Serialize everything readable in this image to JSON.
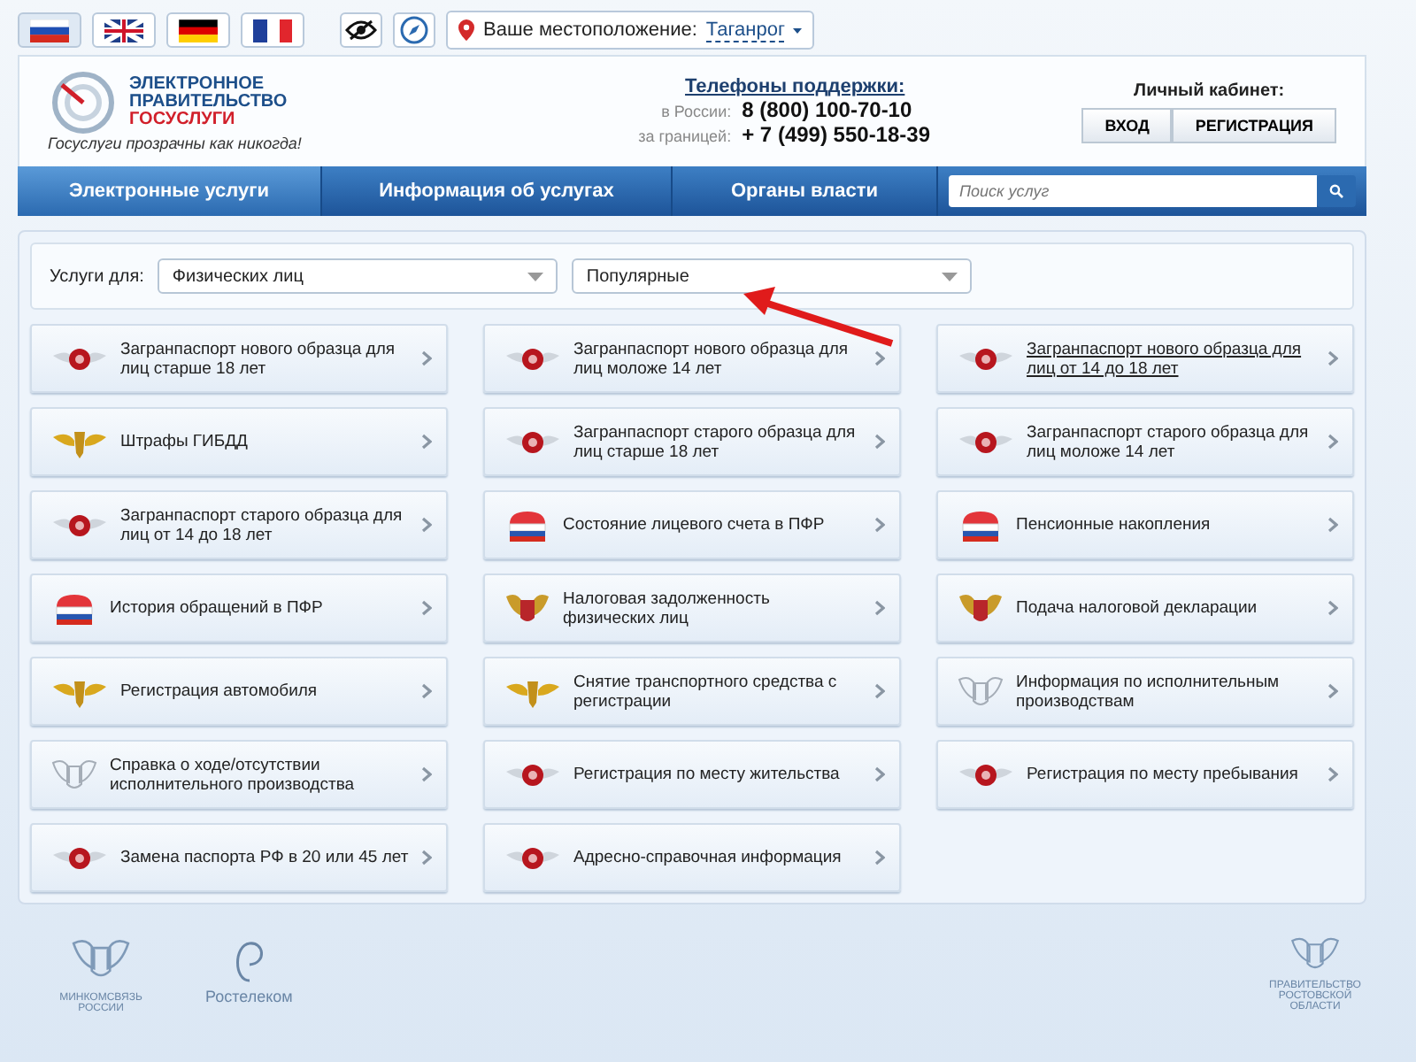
{
  "languages": [
    {
      "kind": "ru",
      "selected": true
    },
    {
      "kind": "en",
      "selected": false
    },
    {
      "kind": "de",
      "selected": false
    },
    {
      "kind": "fr",
      "selected": false
    }
  ],
  "location": {
    "label": "Ваше местоположение:",
    "value": "Таганрог"
  },
  "logo": {
    "line_1": "ЭЛЕКТРОННОЕ",
    "line_2": "ПРАВИТЕЛЬСТВО",
    "line_3": "ГОСУСЛУГИ",
    "slogan": "Госуслуги прозрачны как никогда!"
  },
  "support": {
    "title": "Телефоны поддержки:",
    "phones": [
      {
        "label": "в России:",
        "number": "8 (800) 100-70-10"
      },
      {
        "label": "за границей:",
        "number": "+ 7 (499) 550-18-39"
      }
    ]
  },
  "account": {
    "title": "Личный кабинет:",
    "buttons": [
      "ВХОД",
      "РЕГИСТРАЦИЯ"
    ]
  },
  "nav": {
    "tabs": [
      {
        "label": "Электронные услуги",
        "selected": true
      },
      {
        "label": "Информация об услугах",
        "selected": false
      },
      {
        "label": "Органы власти",
        "selected": false
      }
    ],
    "search": {
      "placeholder": "Поиск услуг"
    }
  },
  "filters": {
    "label": "Услуги для:",
    "audience": "Физических лиц",
    "category": "Популярные"
  },
  "services": [
    {
      "title": "Загранпаспорт нового образца для лиц старше 18 лет",
      "kind": "passport",
      "hovered": false
    },
    {
      "title": "Загранпаспорт нового образца для лиц моложе 14 лет",
      "kind": "passport",
      "hovered": false
    },
    {
      "title": "Загранпаспорт нового образца для лиц от 14 до 18 лет",
      "kind": "passport",
      "hovered": true
    },
    {
      "title": "Штрафы ГИБДД",
      "kind": "eagle",
      "hovered": false
    },
    {
      "title": "Загранпаспорт старого образца для лиц старше 18 лет",
      "kind": "passport",
      "hovered": false
    },
    {
      "title": "Загранпаспорт старого образца для лиц моложе 14 лет",
      "kind": "passport",
      "hovered": false
    },
    {
      "title": "Загранпаспорт старого образца для лиц от 14 до 18 лет",
      "kind": "passport",
      "hovered": false
    },
    {
      "title": "Состояние лицевого счета в ПФР",
      "kind": "pension",
      "hovered": false
    },
    {
      "title": "Пенсионные накопления",
      "kind": "pension",
      "hovered": false
    },
    {
      "title": "История обращений в ПФР",
      "kind": "pension",
      "hovered": false
    },
    {
      "title": "Налоговая задолженность физических лиц",
      "kind": "tax",
      "hovered": false
    },
    {
      "title": "Подача налоговой декларации",
      "kind": "tax",
      "hovered": false
    },
    {
      "title": "Регистрация автомобиля",
      "kind": "eagle",
      "hovered": false
    },
    {
      "title": "Снятие транспортного средства с регистрации",
      "kind": "eagle",
      "hovered": false
    },
    {
      "title": "Информация по исполнительным производствам",
      "kind": "crest",
      "hovered": false
    },
    {
      "title": "Справка о ходе/отсутствии исполнительного производства",
      "kind": "crest",
      "hovered": false
    },
    {
      "title": "Регистрация по месту жительства",
      "kind": "passport",
      "hovered": false
    },
    {
      "title": "Регистрация по месту пребывания",
      "kind": "passport",
      "hovered": false
    },
    {
      "title": "Замена паспорта РФ в 20 или 45 лет",
      "kind": "passport",
      "hovered": false
    },
    {
      "title": "Адресно-справочная информация",
      "kind": "passport",
      "hovered": false
    }
  ],
  "footer": {
    "partners": [
      {
        "kind": "crest",
        "name": "МИНКОМСВЯЗЬ РОССИИ"
      },
      {
        "kind": "ring",
        "name": "Ростелеком"
      }
    ],
    "region": {
      "name": "ПРАВИТЕЛЬСТВО РОСТОВСКОЙ ОБЛАСТИ"
    }
  }
}
